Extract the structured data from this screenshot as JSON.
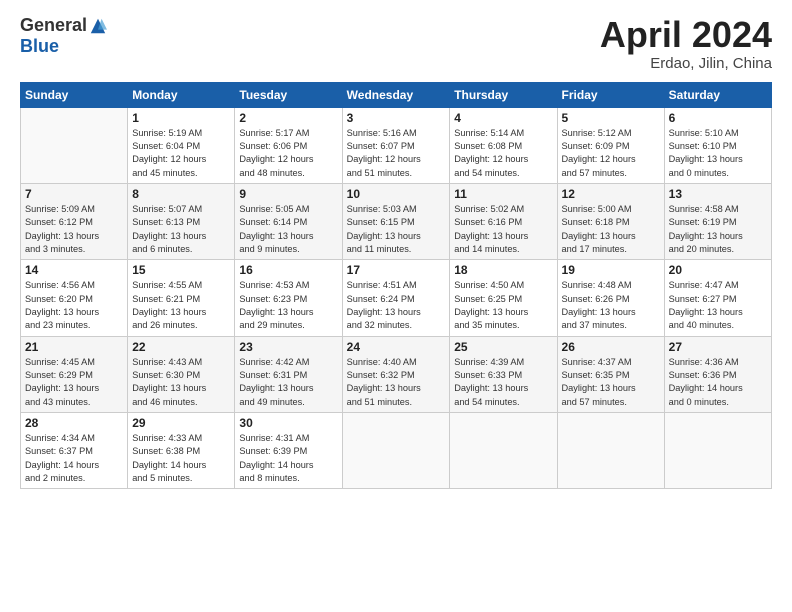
{
  "header": {
    "logo_general": "General",
    "logo_blue": "Blue",
    "month_year": "April 2024",
    "location": "Erdao, Jilin, China"
  },
  "days_of_week": [
    "Sunday",
    "Monday",
    "Tuesday",
    "Wednesday",
    "Thursday",
    "Friday",
    "Saturday"
  ],
  "weeks": [
    [
      {
        "num": "",
        "info": ""
      },
      {
        "num": "1",
        "info": "Sunrise: 5:19 AM\nSunset: 6:04 PM\nDaylight: 12 hours\nand 45 minutes."
      },
      {
        "num": "2",
        "info": "Sunrise: 5:17 AM\nSunset: 6:06 PM\nDaylight: 12 hours\nand 48 minutes."
      },
      {
        "num": "3",
        "info": "Sunrise: 5:16 AM\nSunset: 6:07 PM\nDaylight: 12 hours\nand 51 minutes."
      },
      {
        "num": "4",
        "info": "Sunrise: 5:14 AM\nSunset: 6:08 PM\nDaylight: 12 hours\nand 54 minutes."
      },
      {
        "num": "5",
        "info": "Sunrise: 5:12 AM\nSunset: 6:09 PM\nDaylight: 12 hours\nand 57 minutes."
      },
      {
        "num": "6",
        "info": "Sunrise: 5:10 AM\nSunset: 6:10 PM\nDaylight: 13 hours\nand 0 minutes."
      }
    ],
    [
      {
        "num": "7",
        "info": "Sunrise: 5:09 AM\nSunset: 6:12 PM\nDaylight: 13 hours\nand 3 minutes."
      },
      {
        "num": "8",
        "info": "Sunrise: 5:07 AM\nSunset: 6:13 PM\nDaylight: 13 hours\nand 6 minutes."
      },
      {
        "num": "9",
        "info": "Sunrise: 5:05 AM\nSunset: 6:14 PM\nDaylight: 13 hours\nand 9 minutes."
      },
      {
        "num": "10",
        "info": "Sunrise: 5:03 AM\nSunset: 6:15 PM\nDaylight: 13 hours\nand 11 minutes."
      },
      {
        "num": "11",
        "info": "Sunrise: 5:02 AM\nSunset: 6:16 PM\nDaylight: 13 hours\nand 14 minutes."
      },
      {
        "num": "12",
        "info": "Sunrise: 5:00 AM\nSunset: 6:18 PM\nDaylight: 13 hours\nand 17 minutes."
      },
      {
        "num": "13",
        "info": "Sunrise: 4:58 AM\nSunset: 6:19 PM\nDaylight: 13 hours\nand 20 minutes."
      }
    ],
    [
      {
        "num": "14",
        "info": "Sunrise: 4:56 AM\nSunset: 6:20 PM\nDaylight: 13 hours\nand 23 minutes."
      },
      {
        "num": "15",
        "info": "Sunrise: 4:55 AM\nSunset: 6:21 PM\nDaylight: 13 hours\nand 26 minutes."
      },
      {
        "num": "16",
        "info": "Sunrise: 4:53 AM\nSunset: 6:23 PM\nDaylight: 13 hours\nand 29 minutes."
      },
      {
        "num": "17",
        "info": "Sunrise: 4:51 AM\nSunset: 6:24 PM\nDaylight: 13 hours\nand 32 minutes."
      },
      {
        "num": "18",
        "info": "Sunrise: 4:50 AM\nSunset: 6:25 PM\nDaylight: 13 hours\nand 35 minutes."
      },
      {
        "num": "19",
        "info": "Sunrise: 4:48 AM\nSunset: 6:26 PM\nDaylight: 13 hours\nand 37 minutes."
      },
      {
        "num": "20",
        "info": "Sunrise: 4:47 AM\nSunset: 6:27 PM\nDaylight: 13 hours\nand 40 minutes."
      }
    ],
    [
      {
        "num": "21",
        "info": "Sunrise: 4:45 AM\nSunset: 6:29 PM\nDaylight: 13 hours\nand 43 minutes."
      },
      {
        "num": "22",
        "info": "Sunrise: 4:43 AM\nSunset: 6:30 PM\nDaylight: 13 hours\nand 46 minutes."
      },
      {
        "num": "23",
        "info": "Sunrise: 4:42 AM\nSunset: 6:31 PM\nDaylight: 13 hours\nand 49 minutes."
      },
      {
        "num": "24",
        "info": "Sunrise: 4:40 AM\nSunset: 6:32 PM\nDaylight: 13 hours\nand 51 minutes."
      },
      {
        "num": "25",
        "info": "Sunrise: 4:39 AM\nSunset: 6:33 PM\nDaylight: 13 hours\nand 54 minutes."
      },
      {
        "num": "26",
        "info": "Sunrise: 4:37 AM\nSunset: 6:35 PM\nDaylight: 13 hours\nand 57 minutes."
      },
      {
        "num": "27",
        "info": "Sunrise: 4:36 AM\nSunset: 6:36 PM\nDaylight: 14 hours\nand 0 minutes."
      }
    ],
    [
      {
        "num": "28",
        "info": "Sunrise: 4:34 AM\nSunset: 6:37 PM\nDaylight: 14 hours\nand 2 minutes."
      },
      {
        "num": "29",
        "info": "Sunrise: 4:33 AM\nSunset: 6:38 PM\nDaylight: 14 hours\nand 5 minutes."
      },
      {
        "num": "30",
        "info": "Sunrise: 4:31 AM\nSunset: 6:39 PM\nDaylight: 14 hours\nand 8 minutes."
      },
      {
        "num": "",
        "info": ""
      },
      {
        "num": "",
        "info": ""
      },
      {
        "num": "",
        "info": ""
      },
      {
        "num": "",
        "info": ""
      }
    ]
  ]
}
